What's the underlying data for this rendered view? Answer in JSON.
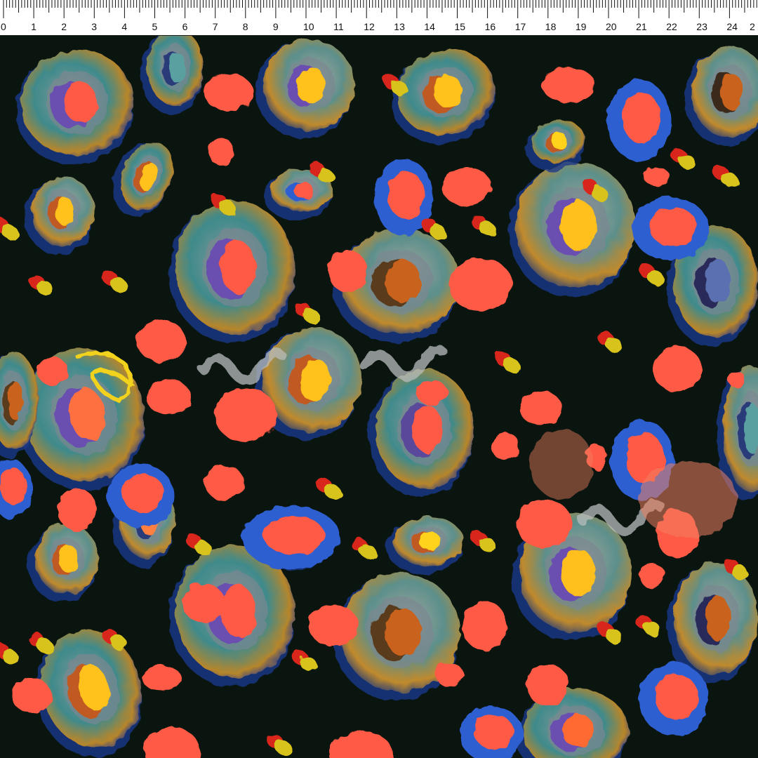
{
  "ruler": {
    "labels": [
      "0",
      "1",
      "2",
      "3",
      "4",
      "5",
      "6",
      "7",
      "8",
      "9",
      "10",
      "11",
      "12",
      "13",
      "14",
      "15",
      "16",
      "17",
      "18",
      "19",
      "20",
      "21",
      "22",
      "23",
      "24",
      "2"
    ],
    "colors": {
      "background": "#ffffff",
      "ticks": "#111111"
    }
  },
  "pattern": {
    "description_color_palette": {
      "background": "#0b1510",
      "coral": "#ff5a45",
      "royal_blue": "#2f5fd0",
      "ochre": "#c9972a",
      "teal": "#3a8a8a",
      "yellow": "#ffd21a",
      "violet": "#6b4fb0",
      "grey": "#9aa3a3"
    }
  }
}
